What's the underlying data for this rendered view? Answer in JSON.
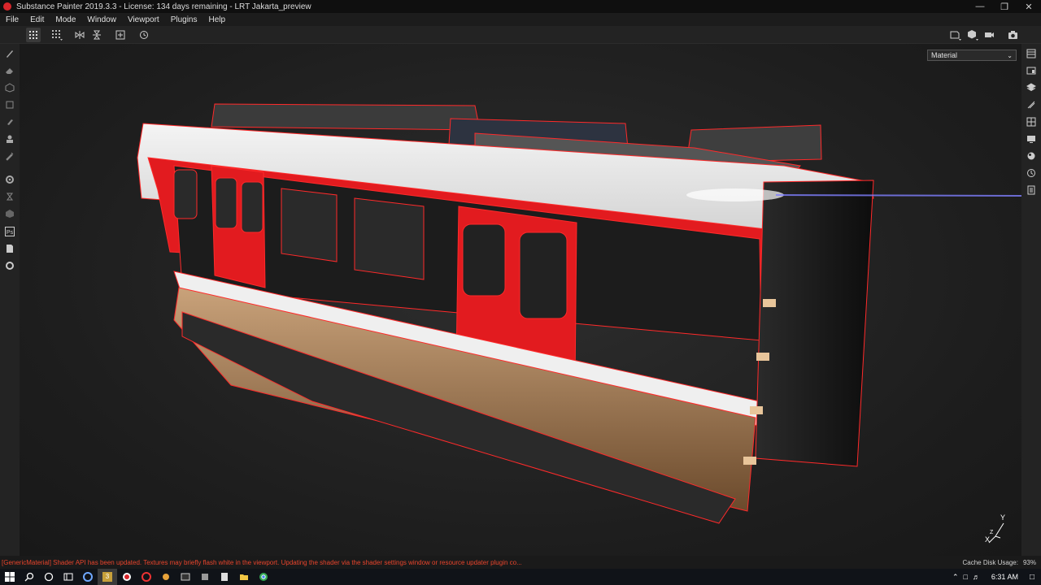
{
  "window": {
    "title": "Substance Painter 2019.3.3 - License: 134 days remaining - LRT Jakarta_preview",
    "accent_color": "#d8262b",
    "controls": [
      "minimize-icon",
      "restore-icon",
      "close-icon"
    ]
  },
  "menu": {
    "items": [
      "File",
      "Edit",
      "Mode",
      "Window",
      "Viewport",
      "Plugins",
      "Help"
    ]
  },
  "toolbar": {
    "left_icons": [
      "grid-icon",
      "grid-dropdown-icon",
      "symmetry-x-icon",
      "symmetry-y-icon",
      "add-frame-icon",
      "history-icon"
    ],
    "right_icons": [
      "frame-dropdown-icon",
      "shading-dropdown-icon",
      "camera-dropdown-icon",
      "screenshot-icon"
    ]
  },
  "left_tools": [
    "paint-brush-icon",
    "eraser-icon",
    "projection-icon",
    "polygon-fill-icon",
    "smudge-icon",
    "clone-icon",
    "color-picker-icon",
    "settings-gear-icon",
    "bake-icon",
    "texture-set-icon",
    "photoshop-export-icon",
    "document-icon",
    "plugin-gear-icon"
  ],
  "right_tools": [
    "layers-icon",
    "texture-set-list-icon",
    "layer-stack-icon",
    "brush-properties-icon",
    "uv-grid-icon",
    "display-settings-icon",
    "shader-sphere-icon",
    "history-clock-icon",
    "log-icon"
  ],
  "viewport": {
    "display_mode": "Material",
    "axis_labels": {
      "y": "Y",
      "x": "X",
      "z": "Z"
    },
    "wire_color": "#ff2a2a"
  },
  "status": {
    "message": "[GenericMaterial] Shader API has been updated. Textures may briefly flash white in the viewport. Updating the shader via the shader settings window or resource updater plugin co...",
    "cache_label": "Cache Disk Usage:",
    "cache_value": "93%"
  },
  "taskbar": {
    "icons": [
      "windows-start-icon",
      "search-icon",
      "cortana-icon",
      "task-view-icon",
      "edge-browser-icon",
      "app-3-icon",
      "substance-icon",
      "app-red-icon",
      "app-flower-icon",
      "app-terminal-icon",
      "app-generic-icon",
      "app-doc-icon",
      "file-explorer-icon",
      "chrome-icon"
    ],
    "tray_icons": [
      "chevron-up-icon",
      "network-icon",
      "volume-icon",
      "notification-icon"
    ],
    "time": "6:31 AM"
  }
}
